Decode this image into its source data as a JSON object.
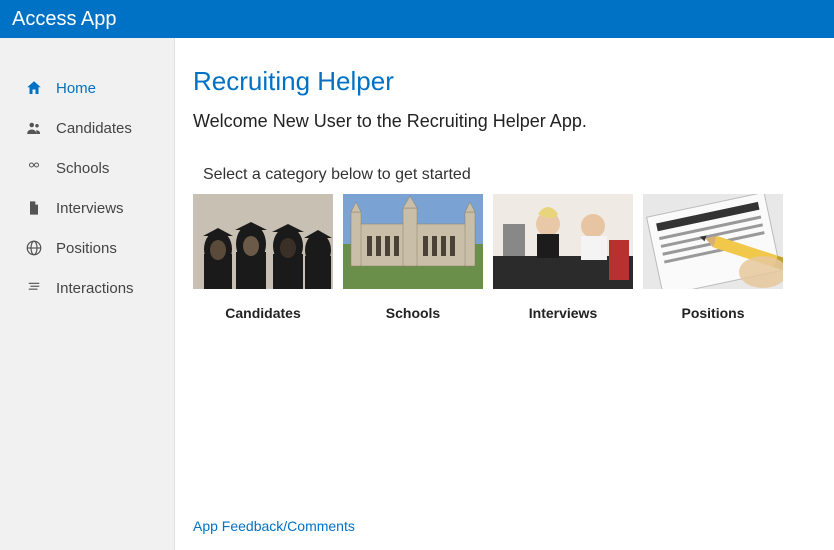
{
  "topbar": {
    "title": "Access App"
  },
  "sidebar": {
    "items": [
      {
        "label": "Home",
        "icon": "home-icon",
        "active": true
      },
      {
        "label": "Candidates",
        "icon": "people-icon",
        "active": false
      },
      {
        "label": "Schools",
        "icon": "glasses-icon",
        "active": false
      },
      {
        "label": "Interviews",
        "icon": "document-icon",
        "active": false
      },
      {
        "label": "Positions",
        "icon": "globe-icon",
        "active": false
      },
      {
        "label": "Interactions",
        "icon": "list-icon",
        "active": false
      }
    ]
  },
  "main": {
    "title": "Recruiting Helper",
    "welcome": "Welcome New User to the Recruiting Helper App.",
    "instruction": "Select a category below to get started",
    "cards": [
      {
        "label": "Candidates"
      },
      {
        "label": "Schools"
      },
      {
        "label": "Interviews"
      },
      {
        "label": "Positions"
      }
    ],
    "feedback": "App Feedback/Comments"
  }
}
